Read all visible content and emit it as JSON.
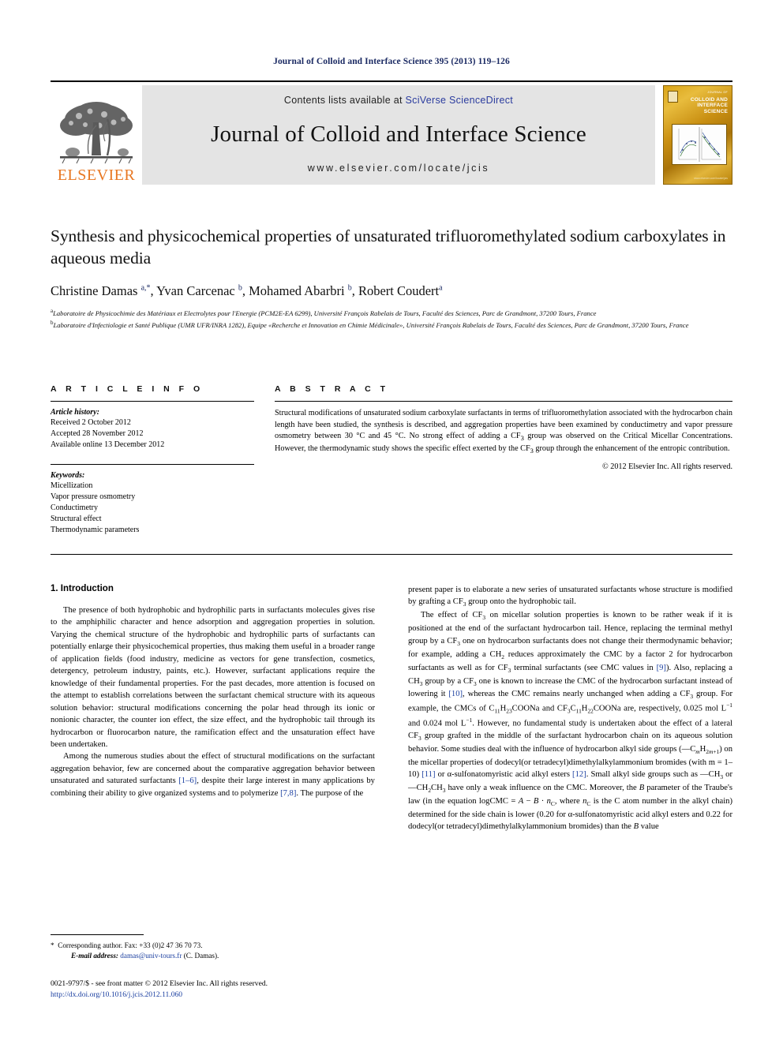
{
  "running_head": "Journal of Colloid and Interface Science 395 (2013) 119–126",
  "masthead": {
    "publisher_name": "ELSEVIER",
    "contents_prefix": "Contents lists available at ",
    "contents_link": "SciVerse ScienceDirect",
    "journal_name": "Journal of Colloid and Interface Science",
    "journal_url": "www.elsevier.com/locate/jcis",
    "cover_supertitle": "JOURNAL OF",
    "cover_title": "COLLOID AND\nINTERFACE\nSCIENCE",
    "cover_footer": "www.elsevier.com/locate/jcis",
    "link_color": "#2a3b9e",
    "brand_color": "#e87722"
  },
  "article": {
    "title": "Synthesis and physicochemical properties of unsaturated trifluoromethylated sodium carboxylates in aqueous media",
    "authors_html": "Christine Damas, Yvan Carcenac, Mohamed Abarbri, Robert Coudert",
    "affiliation_a": "Laboratoire de Physicochimie des Matériaux et Electrolytes pour l'Energie (PCM2E-EA 6299), Université François Rabelais de Tours, Faculté des Sciences, Parc de Grandmont, 37200 Tours, France",
    "affiliation_b": "Laboratoire d'Infectiologie et Santé Publique (UMR UFR/INRA 1282), Equipe «Recherche et Innovation en Chimie Médicinale», Université François Rabelais de Tours, Faculté des Sciences, Parc de Grandmont, 37200 Tours, France"
  },
  "info": {
    "heading": "A R T I C L E   I N F O",
    "history_label": "Article history:",
    "history": [
      "Received 2 October 2012",
      "Accepted 28 November 2012",
      "Available online 13 December 2012"
    ],
    "keywords_label": "Keywords:",
    "keywords": [
      "Micellization",
      "Vapor pressure osmometry",
      "Conductimetry",
      "Structural effect",
      "Thermodynamic parameters"
    ]
  },
  "abstract": {
    "heading": "A B S T R A C T",
    "text": "Structural modifications of unsaturated sodium carboxylate surfactants in terms of trifluoromethylation associated with the hydrocarbon chain length have been studied, the synthesis is described, and aggregation properties have been examined by conductimetry and vapor pressure osmometry between 30 °C and 45 °C. No strong effect of adding a CF3 group was observed on the Critical Micellar Concentrations. However, the thermodynamic study shows the specific effect exerted by the CF3 group through the enhancement of the entropic contribution.",
    "copyright": "© 2012 Elsevier Inc. All rights reserved."
  },
  "body": {
    "section_title": "1. Introduction",
    "left_paragraph_1": "The presence of both hydrophobic and hydrophilic parts in surfactants molecules gives rise to the amphiphilic character and hence adsorption and aggregation properties in solution. Varying the chemical structure of the hydrophobic and hydrophilic parts of surfactants can potentially enlarge their physicochemical properties, thus making them useful in a broader range of application fields (food industry, medicine as vectors for gene transfection, cosmetics, detergency, petroleum industry, paints, etc.). However, surfactant applications require the knowledge of their fundamental properties. For the past decades, more attention is focused on the attempt to establish correlations between the surfactant chemical structure with its aqueous solution behavior: structural modifications concerning the polar head through its ionic or nonionic character, the counter ion effect, the size effect, and the hydrophobic tail through its hydrocarbon or fluorocarbon nature, the ramification effect and the unsaturation effect have been undertaken.",
    "left_paragraph_2_a": "Among the numerous studies about the effect of structural modifications on the surfactant aggregation behavior, few are concerned about the comparative aggregation behavior between unsaturated and saturated surfactants ",
    "left_ref_1": "[1–6]",
    "left_paragraph_2_b": ", despite their large interest in many applications by combining their ability to give organized systems and to polymerize ",
    "left_ref_2": "[7,8]",
    "left_paragraph_2_c": ". The purpose of the",
    "right_paragraph_1": "present paper is to elaborate a new series of unsaturated surfactants whose structure is modified by grafting a CF3 group onto the hydrophobic tail.",
    "right_paragraph_2_a": "The effect of CF3 on micellar solution properties is known to be rather weak if it is positioned at the end of the surfactant hydrocarbon tail. Hence, replacing the terminal methyl group by a CF3 one on hydrocarbon surfactants does not change their thermodynamic behavior; for example, adding a CH2 reduces approximately the CMC by a factor 2 for hydrocarbon surfactants as well as for CF3 terminal surfactants (see CMC values in ",
    "right_ref_9": "[9]",
    "right_paragraph_2_b": "). Also, replacing a CH3 group by a CF3 one is known to increase the CMC of the hydrocarbon surfactant instead of lowering it ",
    "right_ref_10": "[10]",
    "right_paragraph_2_c": ", whereas the CMC remains nearly unchanged when adding a CF3 group. For example, the CMCs of C11H23COONa and CF3C11H22COONa are, respectively, 0.025 mol L−1 and 0.024 mol L−1. However, no fundamental study is undertaken about the effect of a lateral CF3 group grafted in the middle of the surfactant hydrocarbon chain on its aqueous solution behavior. Some studies deal with the influence of hydrocarbon alkyl side groups (—CmH2m+1) on the micellar properties of dodecyl(or tetradecyl)dimethylalkylammonium bromides (with m = 1–10) ",
    "right_ref_11": "[11]",
    "right_paragraph_2_d": " or α-sulfonatomyristic acid alkyl esters ",
    "right_ref_12": "[12]",
    "right_paragraph_2_e": ". Small alkyl side groups such as —CH3 or —CH2CH3 have only a weak influence on the CMC. Moreover, the B parameter of the Traube's law (in the equation logCMC = A − B · nC, where nC is the C atom number in the alkyl chain) determined for the side chain is lower (0.20 for α-sulfonatomyristic acid alkyl esters and 0.22 for dodecyl(or tetradecyl)dimethylalkylammonium bromides) than the B value"
  },
  "footer": {
    "corresponding_marker": "*",
    "corresponding": "Corresponding author. Fax: +33 (0)2 47 36 70 73.",
    "email_label": "E-mail address:",
    "email": "damas@univ-tours.fr",
    "email_suffix": "(C. Damas).",
    "issn_line": "0021-9797/$ - see front matter © 2012 Elsevier Inc. All rights reserved.",
    "doi": "http://dx.doi.org/10.1016/j.jcis.2012.11.060"
  }
}
